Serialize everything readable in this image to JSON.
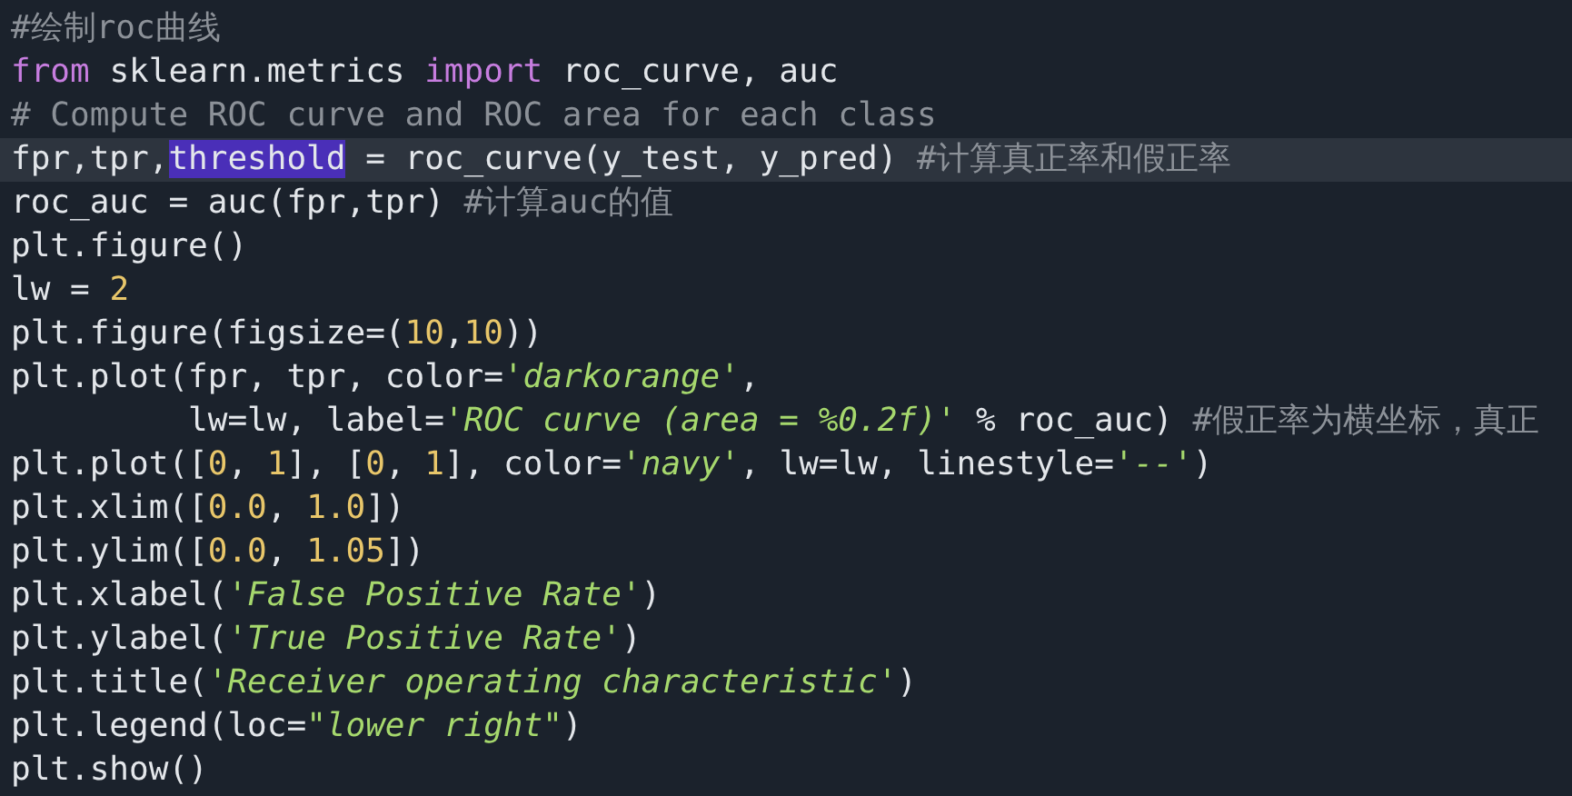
{
  "editor": {
    "lines": [
      {
        "current": false,
        "tokens": [
          {
            "kind": "comment",
            "text": "#绘制roc曲线"
          }
        ]
      },
      {
        "current": false,
        "tokens": [
          {
            "kind": "keyword",
            "text": "from"
          },
          {
            "kind": "plain",
            "text": " sklearn.metrics "
          },
          {
            "kind": "keyword",
            "text": "import"
          },
          {
            "kind": "plain",
            "text": " roc_curve, auc"
          }
        ]
      },
      {
        "current": false,
        "tokens": [
          {
            "kind": "comment",
            "text": "# Compute ROC curve and ROC area for each class"
          }
        ]
      },
      {
        "current": true,
        "tokens": [
          {
            "kind": "plain",
            "text": "fpr,tpr,"
          },
          {
            "kind": "selection",
            "text": "threshold"
          },
          {
            "kind": "plain",
            "text": " = roc_curve(y_test, y_pred) "
          },
          {
            "kind": "comment",
            "text": "#计算真正率和假正率"
          }
        ]
      },
      {
        "current": false,
        "tokens": [
          {
            "kind": "plain",
            "text": "roc_auc = auc(fpr,tpr) "
          },
          {
            "kind": "comment",
            "text": "#计算auc的值"
          }
        ]
      },
      {
        "current": false,
        "tokens": [
          {
            "kind": "plain",
            "text": "plt.figure()"
          }
        ]
      },
      {
        "current": false,
        "tokens": [
          {
            "kind": "plain",
            "text": "lw = "
          },
          {
            "kind": "number",
            "text": "2"
          }
        ]
      },
      {
        "current": false,
        "tokens": [
          {
            "kind": "plain",
            "text": "plt.figure(figsize=("
          },
          {
            "kind": "number",
            "text": "10"
          },
          {
            "kind": "plain",
            "text": ","
          },
          {
            "kind": "number",
            "text": "10"
          },
          {
            "kind": "plain",
            "text": "))"
          }
        ]
      },
      {
        "current": false,
        "tokens": [
          {
            "kind": "plain",
            "text": "plt.plot(fpr, tpr, color="
          },
          {
            "kind": "string",
            "text": "'darkorange'"
          },
          {
            "kind": "plain",
            "text": ","
          }
        ]
      },
      {
        "current": false,
        "tokens": [
          {
            "kind": "plain",
            "text": "         lw=lw, label="
          },
          {
            "kind": "string",
            "text": "'ROC curve (area = %0.2f)'"
          },
          {
            "kind": "plain",
            "text": " % roc_auc) "
          },
          {
            "kind": "comment",
            "text": "#假正率为横坐标，真正"
          }
        ]
      },
      {
        "current": false,
        "tokens": [
          {
            "kind": "plain",
            "text": "plt.plot(["
          },
          {
            "kind": "number",
            "text": "0"
          },
          {
            "kind": "plain",
            "text": ", "
          },
          {
            "kind": "number",
            "text": "1"
          },
          {
            "kind": "plain",
            "text": "], ["
          },
          {
            "kind": "number",
            "text": "0"
          },
          {
            "kind": "plain",
            "text": ", "
          },
          {
            "kind": "number",
            "text": "1"
          },
          {
            "kind": "plain",
            "text": "], color="
          },
          {
            "kind": "string",
            "text": "'navy'"
          },
          {
            "kind": "plain",
            "text": ", lw=lw, linestyle="
          },
          {
            "kind": "string",
            "text": "'--'"
          },
          {
            "kind": "plain",
            "text": ")"
          }
        ]
      },
      {
        "current": false,
        "tokens": [
          {
            "kind": "plain",
            "text": "plt.xlim(["
          },
          {
            "kind": "number",
            "text": "0.0"
          },
          {
            "kind": "plain",
            "text": ", "
          },
          {
            "kind": "number",
            "text": "1.0"
          },
          {
            "kind": "plain",
            "text": "])"
          }
        ]
      },
      {
        "current": false,
        "tokens": [
          {
            "kind": "plain",
            "text": "plt.ylim(["
          },
          {
            "kind": "number",
            "text": "0.0"
          },
          {
            "kind": "plain",
            "text": ", "
          },
          {
            "kind": "number",
            "text": "1.05"
          },
          {
            "kind": "plain",
            "text": "])"
          }
        ]
      },
      {
        "current": false,
        "tokens": [
          {
            "kind": "plain",
            "text": "plt.xlabel("
          },
          {
            "kind": "string",
            "text": "'False Positive Rate'"
          },
          {
            "kind": "plain",
            "text": ")"
          }
        ]
      },
      {
        "current": false,
        "tokens": [
          {
            "kind": "plain",
            "text": "plt.ylabel("
          },
          {
            "kind": "string",
            "text": "'True Positive Rate'"
          },
          {
            "kind": "plain",
            "text": ")"
          }
        ]
      },
      {
        "current": false,
        "tokens": [
          {
            "kind": "plain",
            "text": "plt.title("
          },
          {
            "kind": "string",
            "text": "'Receiver operating characteristic'"
          },
          {
            "kind": "plain",
            "text": ")"
          }
        ]
      },
      {
        "current": false,
        "tokens": [
          {
            "kind": "plain",
            "text": "plt.legend(loc="
          },
          {
            "kind": "string",
            "text": "\"lower right\""
          },
          {
            "kind": "plain",
            "text": ")"
          }
        ]
      },
      {
        "current": false,
        "tokens": [
          {
            "kind": "plain",
            "text": "plt.show()"
          }
        ]
      }
    ]
  }
}
